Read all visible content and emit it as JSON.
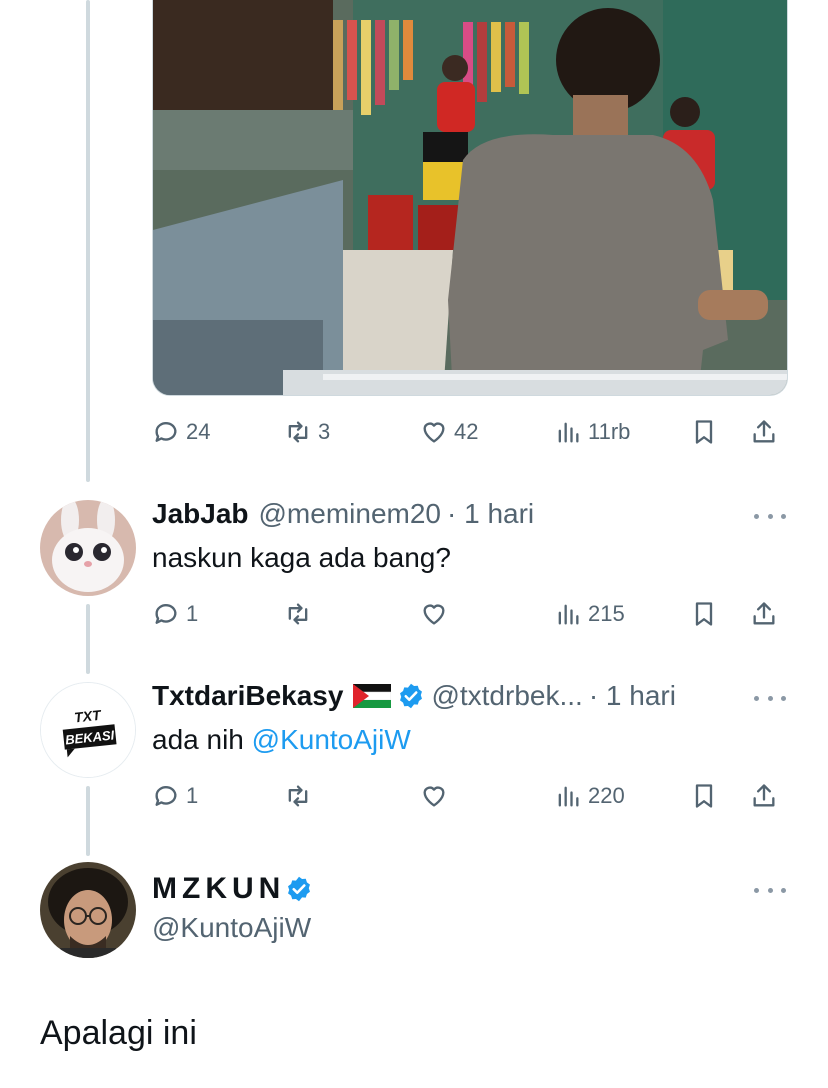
{
  "original_tweet": {
    "actions": {
      "replies": "24",
      "reposts": "3",
      "likes": "42",
      "views": "11rb"
    }
  },
  "replies": [
    {
      "name": "JabJab",
      "handle": "@meminem20",
      "time": "· 1 hari",
      "text": "naskun kaga ada bang?",
      "actions": {
        "replies": "1",
        "views": "215"
      }
    },
    {
      "name": "TxtdariBekasy",
      "flag": "palestine-flag",
      "verified": true,
      "handle": "@txtdrbek...",
      "time": "· 1 hari",
      "text_prefix": "ada nih ",
      "mention": "@KuntoAjiW",
      "avatar_text_line1": "TXT",
      "avatar_text_line2": "BEKASI",
      "actions": {
        "replies": "1",
        "views": "220"
      }
    }
  ],
  "main_tweet": {
    "name": "MZKUN",
    "verified": true,
    "handle": "@KuntoAjiW",
    "text": "Apalagi ini"
  },
  "colors": {
    "text": "#0f1419",
    "secondary": "#536471",
    "link": "#1d9bf0",
    "thread_line": "#cfd9de"
  },
  "icons": [
    "reply-icon",
    "repost-icon",
    "like-icon",
    "views-icon",
    "bookmark-icon",
    "share-icon",
    "more-icon",
    "verified-icon"
  ]
}
